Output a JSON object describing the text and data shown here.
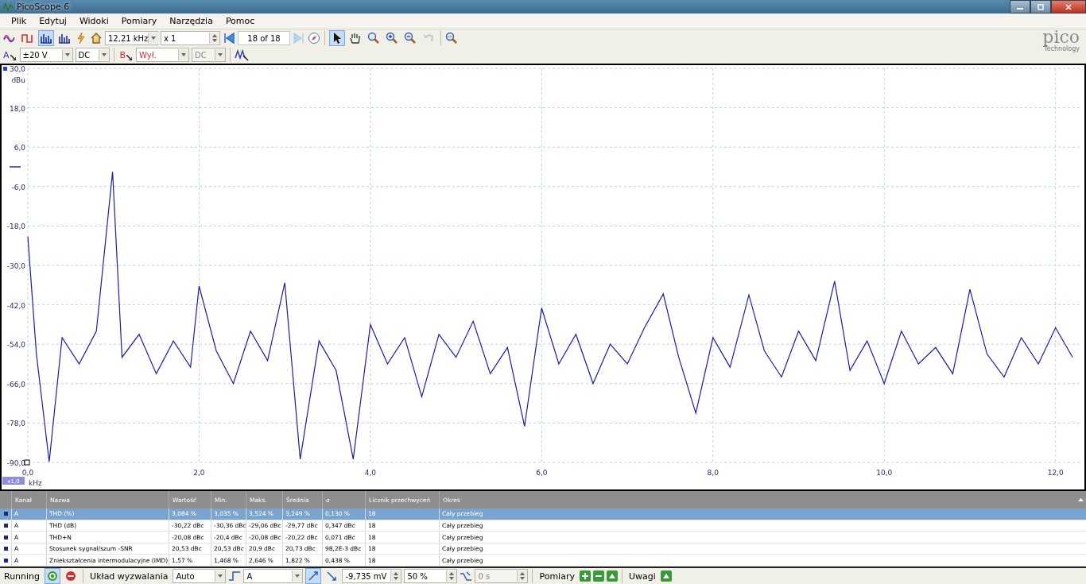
{
  "window": {
    "title": "PicoScope 6"
  },
  "menu": [
    "Plik",
    "Edytuj",
    "Widoki",
    "Pomiary",
    "Narzędzia",
    "Pomoc"
  ],
  "toolbar": {
    "view_modes": [
      {
        "selected": false
      },
      {
        "selected": false
      },
      {
        "selected": true
      },
      {
        "selected": false
      }
    ],
    "timebase": "12,21 kHz",
    "multiplier": "x 1",
    "capture": "18 of 18",
    "tools": [
      {
        "selected": true
      },
      {
        "selected": false
      },
      {
        "selected": false
      },
      {
        "selected": false
      },
      {
        "selected": false
      },
      {
        "selected": false
      }
    ]
  },
  "logo": {
    "name": "pico",
    "tagline": "Technology"
  },
  "channels": [
    {
      "label": "A",
      "range": "±20 V",
      "coupling": "DC",
      "disabled": false,
      "color": "#2a3fc8"
    },
    {
      "label": "B",
      "range": "Wył.",
      "coupling": "DC",
      "disabled": true,
      "color": "#d03030"
    }
  ],
  "chart": {
    "zoom_badge": "x1,0",
    "chart_data": {
      "type": "line",
      "grid": true,
      "xlabel": "kHz",
      "ylabel": "dBu",
      "xlim": [
        0,
        12.3
      ],
      "ylim": [
        -90,
        30
      ],
      "xticks": [
        {
          "value": 0,
          "label": "0,0"
        },
        {
          "value": 2,
          "label": "2,0"
        },
        {
          "value": 4,
          "label": "4,0"
        },
        {
          "value": 6,
          "label": "6,0"
        },
        {
          "value": 8,
          "label": "8,0"
        },
        {
          "value": 10,
          "label": "10,0"
        },
        {
          "value": 12,
          "label": "12,0"
        }
      ],
      "yticks": [
        {
          "value": 30,
          "label": "30,0"
        },
        {
          "value": 18,
          "label": "18,0"
        },
        {
          "value": 6,
          "label": "6,0"
        },
        {
          "value": -6,
          "label": "-6,0"
        },
        {
          "value": -18,
          "label": "-18,0"
        },
        {
          "value": -30,
          "label": "-30,0"
        },
        {
          "value": -42,
          "label": "-42,0"
        },
        {
          "value": -54,
          "label": "-54,0"
        },
        {
          "value": -66,
          "label": "-66,0"
        },
        {
          "value": -78,
          "label": "-78,0"
        },
        {
          "value": -90,
          "label": "-90,0"
        }
      ],
      "x": [
        0,
        0.1,
        0.25,
        0.4,
        0.6,
        0.8,
        0.99,
        1.1,
        1.3,
        1.5,
        1.7,
        1.9,
        2.0,
        2.2,
        2.4,
        2.6,
        2.8,
        3.0,
        3.18,
        3.4,
        3.6,
        3.8,
        4.0,
        4.2,
        4.4,
        4.6,
        4.8,
        5.0,
        5.2,
        5.4,
        5.6,
        5.8,
        6.0,
        6.2,
        6.4,
        6.6,
        6.8,
        7.0,
        7.2,
        7.42,
        7.6,
        7.8,
        8.0,
        8.2,
        8.42,
        8.6,
        8.8,
        9.0,
        9.2,
        9.42,
        9.6,
        9.8,
        10.0,
        10.2,
        10.4,
        10.6,
        10.8,
        11.0,
        11.2,
        11.4,
        11.6,
        11.8,
        12.0,
        12.2
      ],
      "series": [
        {
          "color": "#1c1ca8",
          "values": [
            -21.3,
            -57,
            -89.8,
            -52,
            -60,
            -50,
            -1.5,
            -58,
            -51,
            -63,
            -53,
            -61,
            -36.3,
            -56,
            -66,
            -50,
            -59,
            -35.3,
            -89,
            -53,
            -62,
            -89,
            -48,
            -60,
            -52,
            -70,
            -51,
            -58,
            -47,
            -63,
            -55,
            -79,
            -43,
            -60,
            -51,
            -66,
            -54,
            -60,
            -49,
            -38.7,
            -58,
            -75,
            -52,
            -61,
            -39,
            -56,
            -64,
            -50,
            -59,
            -34.8,
            -62,
            -53,
            -66,
            -50,
            -60,
            -55,
            -63,
            -37.3,
            -57,
            -64,
            -52,
            -60,
            -49,
            -58
          ]
        }
      ]
    }
  },
  "measurements": {
    "columns": [
      "Kanał",
      "Nazwa",
      "Wartość",
      "Min.",
      "Maks.",
      "Średnia",
      "σ",
      "Licznik przechwyceń",
      "Okres"
    ],
    "rows": [
      {
        "selected": true,
        "cells": [
          "A",
          "THD (%)",
          "3,084 %",
          "3,035 %",
          "3,524 %",
          "3,249 %",
          "0,130 %",
          "18",
          "Cały przebieg"
        ]
      },
      {
        "selected": false,
        "cells": [
          "A",
          "THD (dB)",
          "-30,22 dBc",
          "-30,36 dBc",
          "-29,06 dBc",
          "-29,77 dBc",
          "0,347 dBc",
          "18",
          "Cały przebieg"
        ]
      },
      {
        "selected": false,
        "cells": [
          "A",
          "THD+N",
          "-20,08 dBc",
          "-20,4 dBc",
          "-20,08 dBc",
          "-20,22 dBc",
          "0,071 dBc",
          "18",
          "Cały przebieg"
        ]
      },
      {
        "selected": false,
        "cells": [
          "A",
          "Stosunek sygnał/szum -SNR",
          "20,53 dBc",
          "20,53 dBc",
          "20,9 dBc",
          "20,73 dBc",
          "98,2E-3 dBc",
          "18",
          "Cały przebieg"
        ]
      },
      {
        "selected": false,
        "cells": [
          "A",
          "Zniekształcenia intermodulacyjne (IMD)",
          "1,57 %",
          "1,468 %",
          "2,646 %",
          "1,822 %",
          "0,438 %",
          "18",
          "Cały przebieg"
        ]
      }
    ]
  },
  "status": {
    "run_state": "Running",
    "trigger_label": "Układ wyzwalania",
    "trigger_mode": "Auto",
    "trigger_source": "A",
    "rising_selected": true,
    "trigger_level": "-9,735 mV",
    "pretrigger": "50 %",
    "delay": "0 s",
    "measurements_label": "Pomiary",
    "notes_label": "Uwagi"
  }
}
